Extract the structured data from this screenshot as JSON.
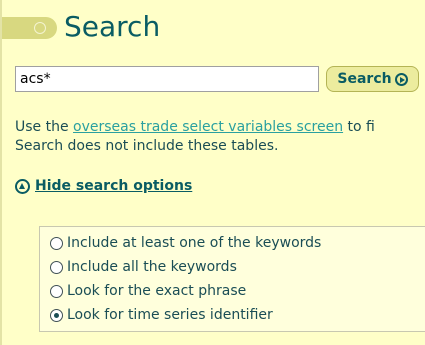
{
  "header": {
    "title": "Search"
  },
  "search": {
    "value": "acs*",
    "button_label": "Search"
  },
  "info": {
    "prefix": "Use the ",
    "link": "overseas trade select variables screen",
    "suffix": " to fi",
    "line2": "Search does not include these tables."
  },
  "options_toggle": {
    "label": "Hide search options"
  },
  "options": [
    {
      "label": "Include at least one of the keywords",
      "checked": false
    },
    {
      "label": "Include all the keywords",
      "checked": false
    },
    {
      "label": "Look for the exact phrase",
      "checked": false
    },
    {
      "label": "Look for time series identifier",
      "checked": true
    }
  ],
  "colors": {
    "accent": "#0a5c63",
    "link": "#2aa0a0",
    "panel": "#ffffc8"
  }
}
